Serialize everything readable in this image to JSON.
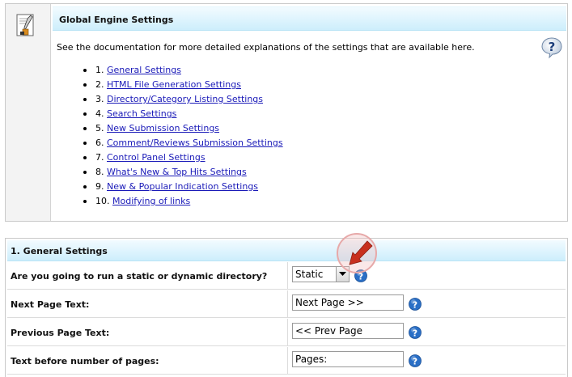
{
  "top": {
    "title": "Global Engine Settings",
    "intro": "See the documentation for more detailed explanations of the settings that are available here.",
    "icons": {
      "page": "document-edit-icon",
      "help": "help-bubble-icon"
    },
    "toc": [
      {
        "num": "1.",
        "label": "General Settings"
      },
      {
        "num": "2.",
        "label": "HTML File Generation Settings"
      },
      {
        "num": "3.",
        "label": "Directory/Category Listing Settings"
      },
      {
        "num": "4.",
        "label": "Search Settings"
      },
      {
        "num": "5.",
        "label": "New Submission Settings"
      },
      {
        "num": "6.",
        "label": "Comment/Reviews Submission Settings"
      },
      {
        "num": "7.",
        "label": "Control Panel Settings"
      },
      {
        "num": "8.",
        "label": "What's New & Top Hits Settings"
      },
      {
        "num": "9.",
        "label": "New & Popular Indication Settings"
      },
      {
        "num": "10.",
        "label": "Modifying of links"
      }
    ]
  },
  "general": {
    "title": "1. General Settings",
    "rows": [
      {
        "label": "Are you going to run a static or dynamic directory?",
        "type": "select",
        "value": "Static"
      },
      {
        "label": "Next Page Text:",
        "type": "text",
        "value": "Next Page >>"
      },
      {
        "label": "Previous Page Text:",
        "type": "text",
        "value": "<< Prev Page"
      },
      {
        "label": "Text before number of pages:",
        "type": "text",
        "value": "Pages:"
      }
    ]
  },
  "colors": {
    "header_gradient_top": "#f2fbff",
    "header_gradient_bottom": "#cdeefc",
    "link": "#1a1ab8",
    "help_icon": "#2a6fc6",
    "pointer_arrow": "#c8301e"
  }
}
